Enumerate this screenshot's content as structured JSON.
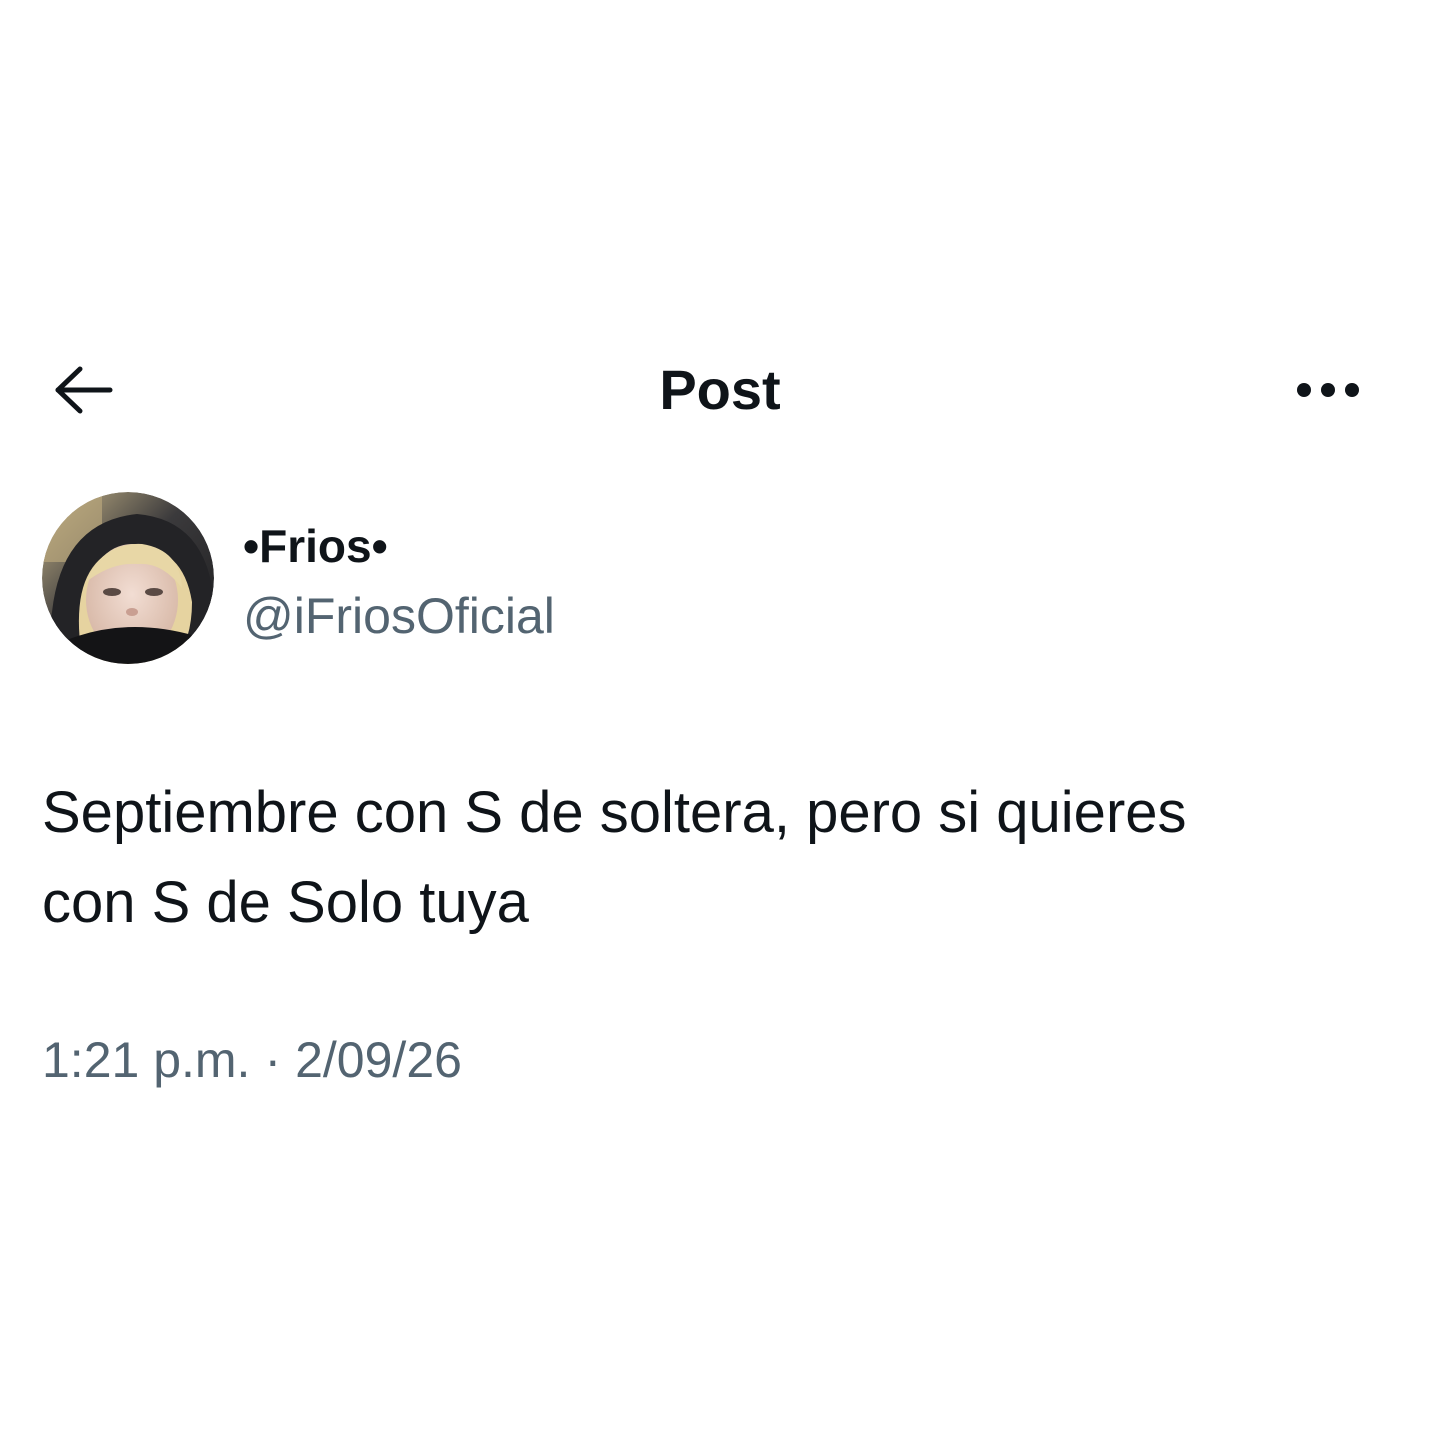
{
  "header": {
    "back_icon": "arrow-left-icon",
    "title": "Post",
    "more_icon": "more-horizontal-icon"
  },
  "author": {
    "display_name": "•Frios•",
    "handle": "@iFriosOficial",
    "avatar": "profile-photo"
  },
  "post": {
    "text_lines": [
      "Septiembre con S de soltera, pero si quieres",
      "con S de Solo tuya"
    ],
    "time": "1:21 p.m.",
    "separator": "·",
    "date": "2/09/26"
  },
  "colors": {
    "text_primary": "#0f1419",
    "text_secondary": "#536471",
    "background": "#ffffff"
  }
}
